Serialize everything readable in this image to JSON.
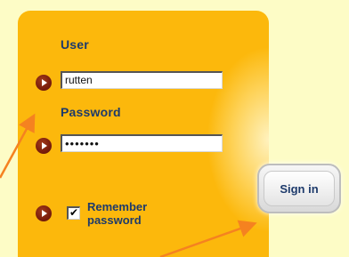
{
  "form": {
    "user_label": "User",
    "user_value": "rutten",
    "password_label": "Password",
    "password_value": "•••••••",
    "remember_checked_mark": "✔",
    "remember_label": "Remember password",
    "signin_label": "Sign in"
  },
  "colors": {
    "page_background": "#fdfcc6",
    "panel": "#fcb80c",
    "label_text": "#1d3a6b",
    "bullet": "#7a1d0c",
    "annotation_arrow": "#f58220"
  },
  "icons": {
    "field_bullet": "play-bullet-icon",
    "annotation": "arrow-pointer"
  }
}
